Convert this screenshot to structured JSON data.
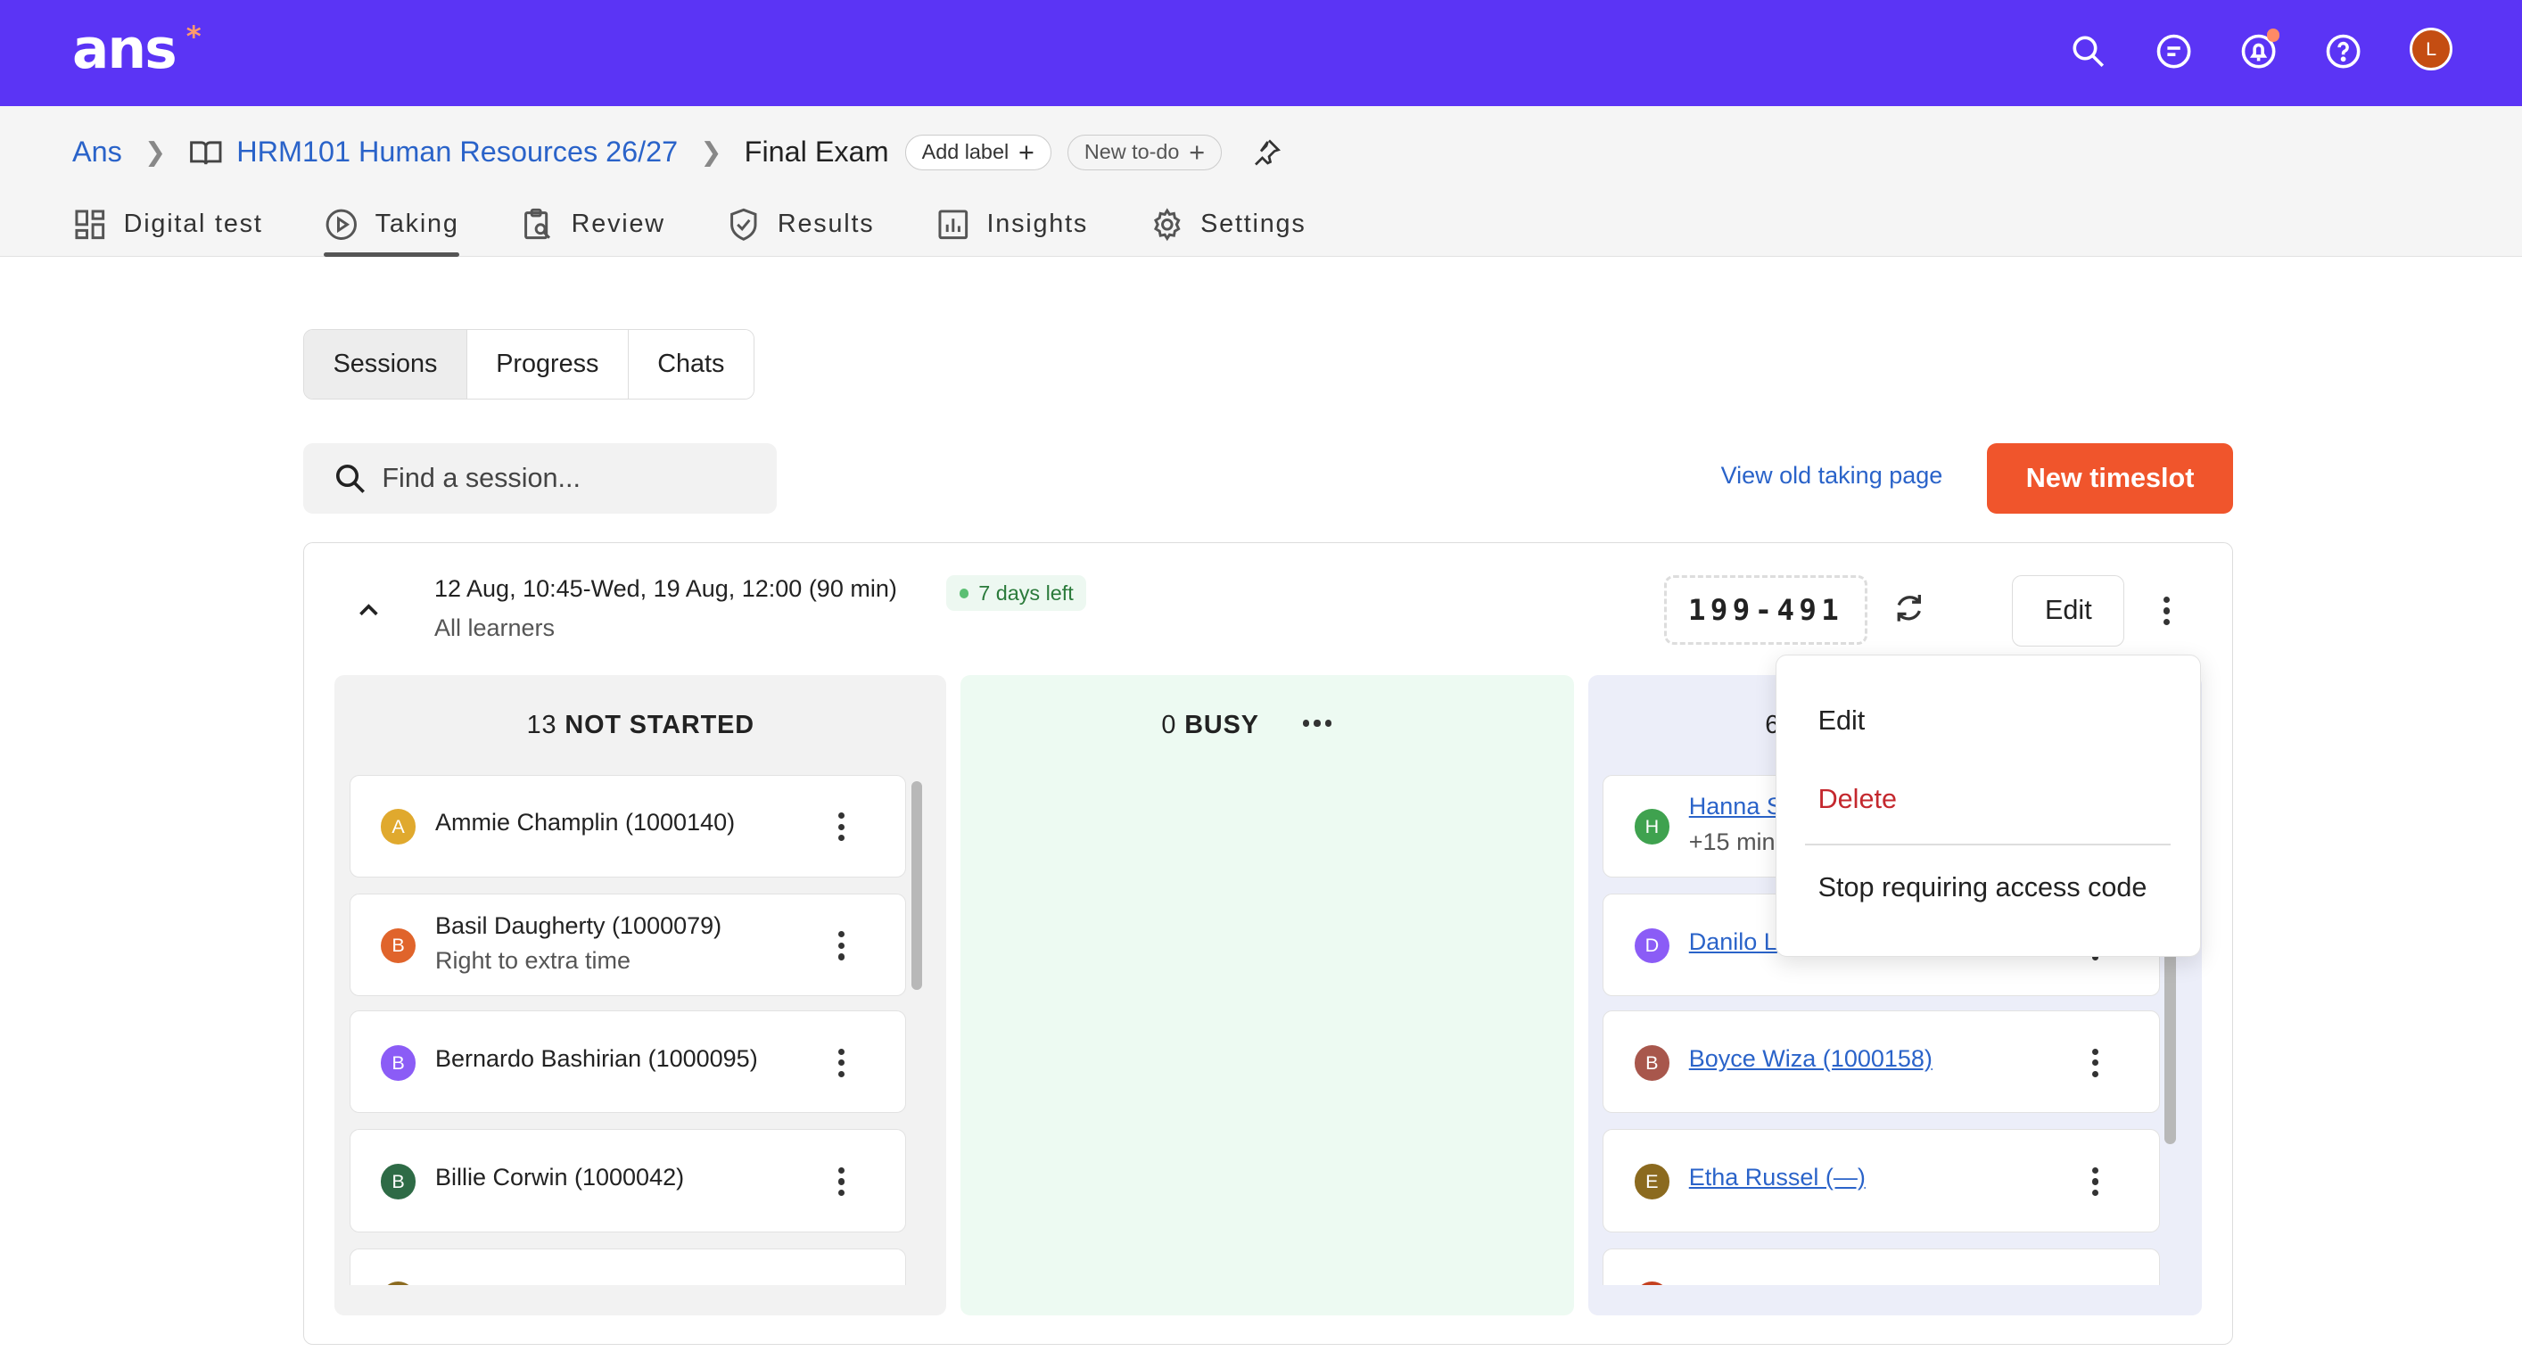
{
  "app": {
    "logo": "ans",
    "logo_mark": "*"
  },
  "topbar": {
    "avatar_initial": "L"
  },
  "breadcrumb": {
    "root": "Ans",
    "course": "HRM101 Human Resources 26/27",
    "current": "Final Exam",
    "add_label": "Add label",
    "new_todo": "New to-do"
  },
  "tabs": [
    {
      "label": "Digital test"
    },
    {
      "label": "Taking"
    },
    {
      "label": "Review"
    },
    {
      "label": "Results"
    },
    {
      "label": "Insights"
    },
    {
      "label": "Settings"
    }
  ],
  "subtabs": [
    "Sessions",
    "Progress",
    "Chats"
  ],
  "search": {
    "placeholder": "Find a session..."
  },
  "actions": {
    "old_page": "View old taking page",
    "new_timeslot": "New timeslot"
  },
  "timeslot": {
    "when": "12 Aug, 10:45-Wed, 19 Aug, 12:00 (90 min)",
    "days_left": "7 days left",
    "who": "All learners",
    "access_code": "199-491",
    "edit": "Edit"
  },
  "columns": {
    "not_started": {
      "count": "13",
      "label": "NOT STARTED"
    },
    "busy": {
      "count": "0",
      "label": "BUSY"
    },
    "finished": {
      "count": "6"
    }
  },
  "not_started_items": [
    {
      "initial": "A",
      "color": "#e0a92e",
      "name": "Ammie Champlin (1000140)",
      "sub": ""
    },
    {
      "initial": "B",
      "color": "#e0642b",
      "name": "Basil Daugherty (1000079)",
      "sub": "Right to extra time"
    },
    {
      "initial": "B",
      "color": "#8b5cf6",
      "name": "Bernardo Bashirian (1000095)",
      "sub": ""
    },
    {
      "initial": "B",
      "color": "#2e6b46",
      "name": "Billie Corwin (1000042)",
      "sub": ""
    }
  ],
  "finished_items": [
    {
      "initial": "H",
      "color": "#3fa24f",
      "name": "Hanna S",
      "sub": "+15 min"
    },
    {
      "initial": "D",
      "color": "#8b5cf6",
      "name": "Danilo L",
      "sub": ""
    },
    {
      "initial": "B",
      "color": "#a8574c",
      "name": "Boyce Wiza (1000158)",
      "sub": ""
    },
    {
      "initial": "E",
      "color": "#8b6a1f",
      "name": "Etha Russel (—)",
      "sub": ""
    }
  ],
  "menu": {
    "edit": "Edit",
    "delete": "Delete",
    "stop_code": "Stop requiring access code"
  }
}
